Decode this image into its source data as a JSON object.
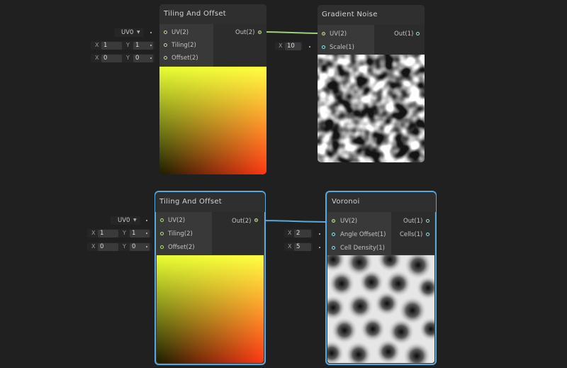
{
  "nodes": {
    "tiling_top": {
      "title": "Tiling And Offset",
      "inputs": [
        "UV(2)",
        "Tiling(2)",
        "Offset(2)"
      ],
      "output": "Out(2)",
      "uv_dropdown": "UV0",
      "tiling": {
        "x_label": "X",
        "x": "1",
        "y_label": "Y",
        "y": "1"
      },
      "offset": {
        "x_label": "X",
        "x": "0",
        "y_label": "Y",
        "y": "0"
      }
    },
    "gradient_noise": {
      "title": "Gradient Noise",
      "inputs": [
        "UV(2)",
        "Scale(1)"
      ],
      "output": "Out(1)",
      "scale": {
        "x_label": "X",
        "x": "10"
      }
    },
    "tiling_bottom": {
      "title": "Tiling And Offset",
      "inputs": [
        "UV(2)",
        "Tiling(2)",
        "Offset(2)"
      ],
      "output": "Out(2)",
      "uv_dropdown": "UV0",
      "tiling": {
        "x_label": "X",
        "x": "1",
        "y_label": "Y",
        "y": "1"
      },
      "offset": {
        "x_label": "X",
        "x": "0",
        "y_label": "Y",
        "y": "0"
      }
    },
    "voronoi": {
      "title": "Voronoi",
      "inputs": [
        "UV(2)",
        "Angle Offset(1)",
        "Cell Density(1)"
      ],
      "outputs": [
        "Out(1)",
        "Cells(1)"
      ],
      "angle_offset": {
        "x_label": "X",
        "x": "2"
      },
      "cell_density": {
        "x_label": "X",
        "x": "5"
      }
    }
  },
  "colors": {
    "background": "#202020",
    "node": "#393939",
    "selection": "#5ba7db",
    "vector2_port": "#b6e486",
    "vector1_port": "#8ee3ee",
    "edge_v2": "#9fd07c",
    "edge_selected": "#5ba7db"
  }
}
